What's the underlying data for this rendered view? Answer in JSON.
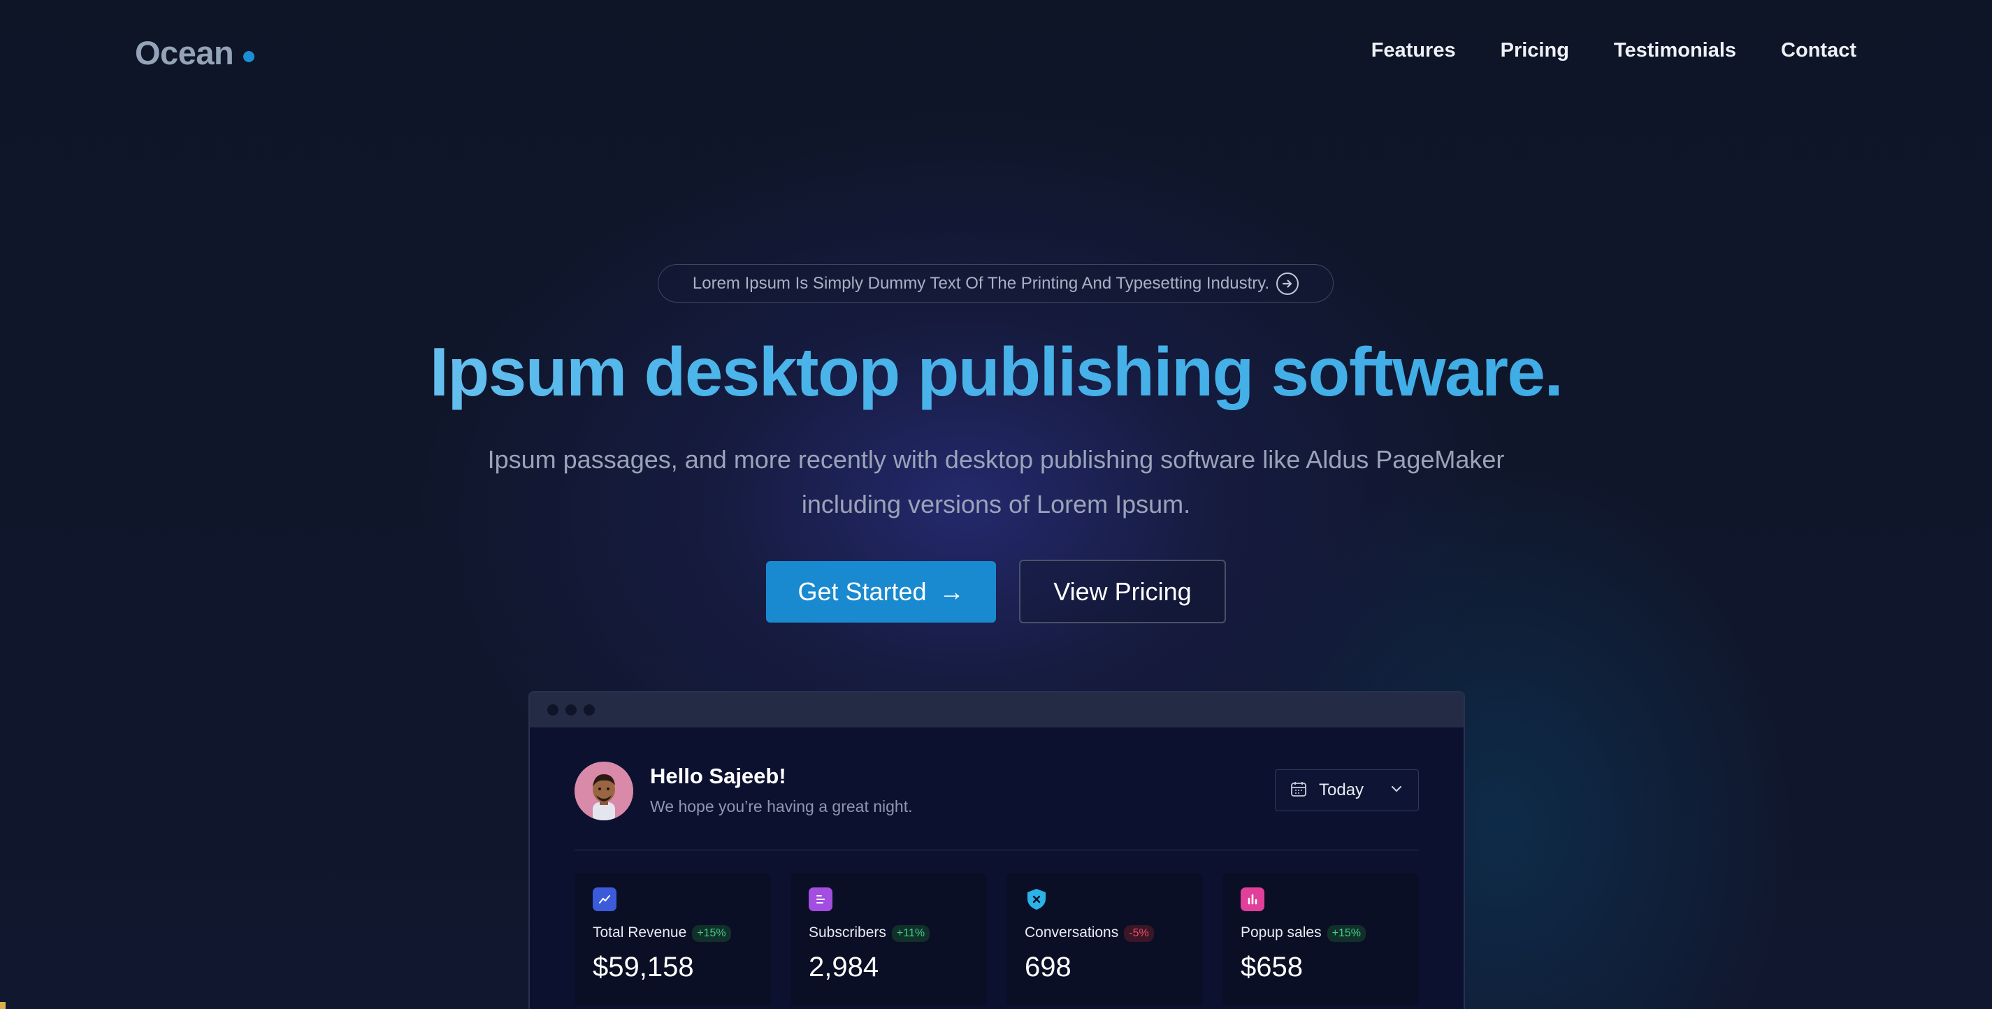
{
  "nav": {
    "logo": "Ocean",
    "links": [
      "Features",
      "Pricing",
      "Testimonials",
      "Contact"
    ]
  },
  "hero": {
    "announcement": "Lorem Ipsum Is Simply Dummy Text Of The Printing And Typesetting Industry.",
    "headline": "Ipsum desktop publishing software.",
    "subtitle": "Ipsum passages, and more recently with desktop publishing software like Aldus PageMaker including versions of Lorem Ipsum.",
    "primary_cta": "Get Started",
    "primary_cta_arrow": "→",
    "secondary_cta": "View Pricing"
  },
  "dashboard": {
    "greeting": "Hello Sajeeb!",
    "greeting_sub": "We hope you’re having a great night.",
    "date_filter": "Today",
    "cards": [
      {
        "label": "Total Revenue",
        "change": "+15%",
        "trend": "up",
        "value": "$59,158",
        "icon": "chart-up-icon",
        "color": "#3b5bdb"
      },
      {
        "label": "Subscribers",
        "change": "+11%",
        "trend": "up",
        "value": "2,984",
        "icon": "list-icon",
        "color": "#a34ee0"
      },
      {
        "label": "Conversations",
        "change": "-5%",
        "trend": "down",
        "value": "698",
        "icon": "shield-x-icon",
        "color": "#2bb3e8"
      },
      {
        "label": "Popup sales",
        "change": "+15%",
        "trend": "up",
        "value": "$658",
        "icon": "bar-chart-icon",
        "color": "#e0409a"
      }
    ]
  },
  "colors": {
    "accent": "#1a8ad0",
    "background": "#0e1527",
    "headline_gradient": [
      "#8fd0f5",
      "#3aa8e4"
    ]
  }
}
